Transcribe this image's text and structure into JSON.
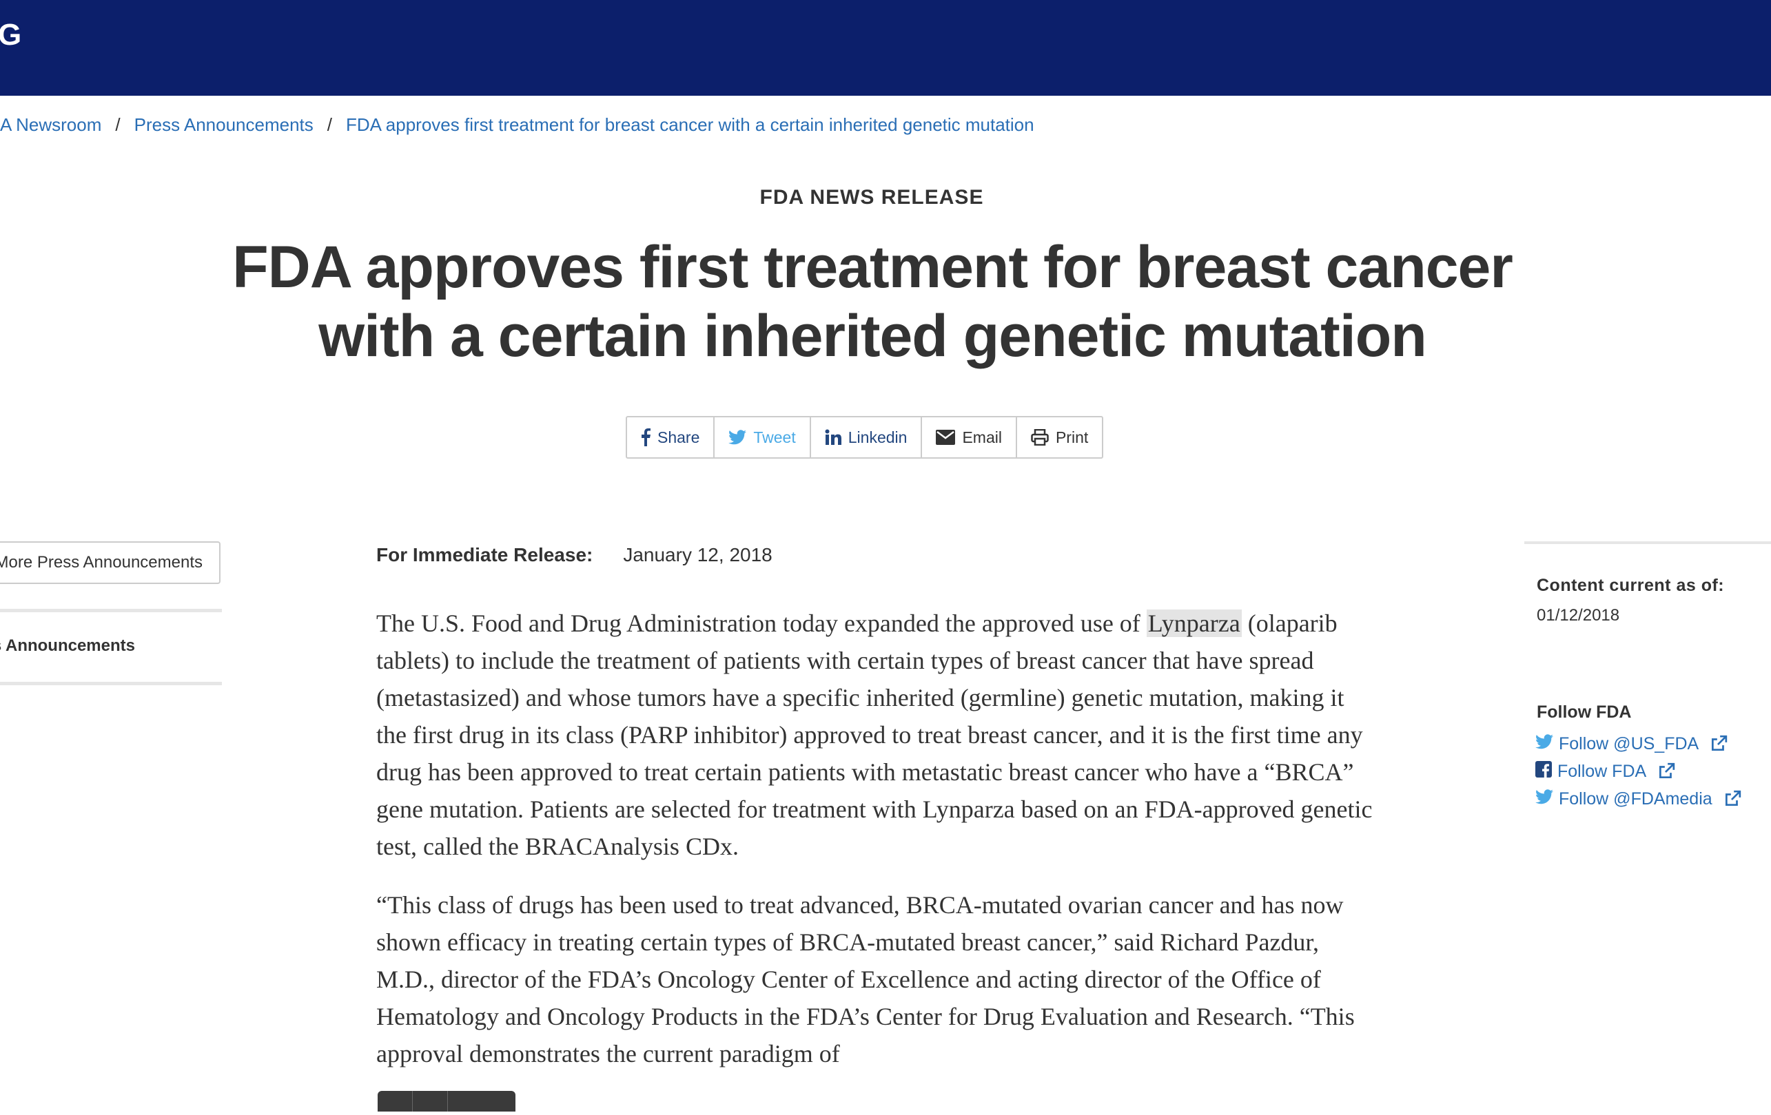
{
  "header": {
    "logo_partial": "G",
    "bg_color": "#0c1f6b"
  },
  "breadcrumb": {
    "items": [
      "A Newsroom",
      "Press Announcements",
      "FDA approves first treatment for breast cancer with a certain inherited genetic mutation"
    ],
    "separator": "/"
  },
  "article": {
    "kicker": "FDA NEWS RELEASE",
    "title": "FDA approves first treatment for breast cancer with a certain inherited genetic mutation",
    "share_buttons": [
      {
        "label": "Share",
        "icon": "facebook-icon"
      },
      {
        "label": "Tweet",
        "icon": "twitter-icon"
      },
      {
        "label": "Linkedin",
        "icon": "linkedin-icon"
      },
      {
        "label": "Email",
        "icon": "envelope-icon"
      },
      {
        "label": "Print",
        "icon": "printer-icon"
      }
    ],
    "release_label": "For Immediate Release:",
    "release_date": "January 12, 2018",
    "p1_before": "The U.S. Food and Drug Administration today expanded the approved use of ",
    "p1_highlight": "Lynparza",
    "p1_after": " (olaparib tablets) to include the treatment of patients with certain types of breast cancer that have spread (metastasized) and whose tumors have a specific inherited (germline) genetic mutation, making it the first drug in its class (PARP inhibitor) approved to treat breast cancer, and it is the first time any drug has been approved to treat certain patients with metastatic breast cancer who have a “BRCA” gene mutation. Patients are selected for treatment with Lynparza based on an FDA-approved genetic test, called the BRACAnalysis CDx.",
    "p2": "“This class of drugs has been used to treat advanced, BRCA-mutated ovarian cancer and has now shown efficacy in treating certain types of BRCA-mutated breast cancer,” said Richard Pazdur, M.D., director of the FDA’s Oncology Center of Excellence and acting director of the Office of Hematology and Oncology Products in the FDA’s Center for Drug Evaluation and Research. “This approval demonstrates the current paradigm of"
  },
  "left_sidebar": {
    "more_button": "More Press Announcements",
    "link": "Press Announcements"
  },
  "right_sidebar": {
    "content_label": "Content current as of:",
    "content_date": "01/12/2018",
    "follow_heading": "Follow FDA",
    "follow_links": [
      {
        "label": "Follow @US_FDA",
        "icon": "twitter-icon"
      },
      {
        "label": "Follow FDA",
        "icon": "facebook-square-icon"
      },
      {
        "label": "Follow @FDAmedia",
        "icon": "twitter-icon"
      }
    ]
  }
}
